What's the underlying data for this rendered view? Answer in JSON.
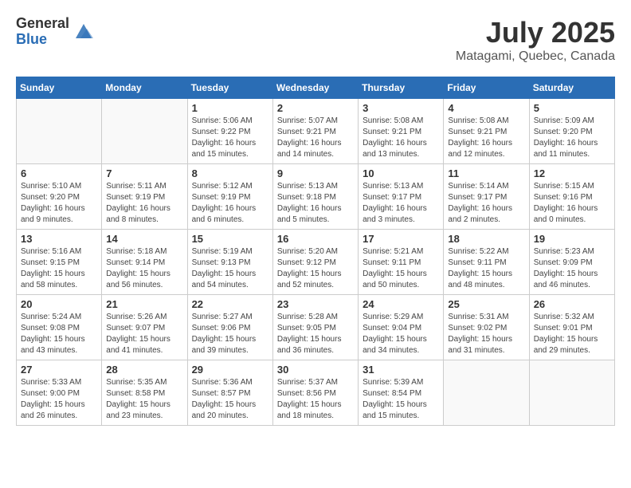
{
  "header": {
    "logo_general": "General",
    "logo_blue": "Blue",
    "month_title": "July 2025",
    "location": "Matagami, Quebec, Canada"
  },
  "days_of_week": [
    "Sunday",
    "Monday",
    "Tuesday",
    "Wednesday",
    "Thursday",
    "Friday",
    "Saturday"
  ],
  "weeks": [
    [
      {
        "day": "",
        "detail": ""
      },
      {
        "day": "",
        "detail": ""
      },
      {
        "day": "1",
        "detail": "Sunrise: 5:06 AM\nSunset: 9:22 PM\nDaylight: 16 hours and 15 minutes."
      },
      {
        "day": "2",
        "detail": "Sunrise: 5:07 AM\nSunset: 9:21 PM\nDaylight: 16 hours and 14 minutes."
      },
      {
        "day": "3",
        "detail": "Sunrise: 5:08 AM\nSunset: 9:21 PM\nDaylight: 16 hours and 13 minutes."
      },
      {
        "day": "4",
        "detail": "Sunrise: 5:08 AM\nSunset: 9:21 PM\nDaylight: 16 hours and 12 minutes."
      },
      {
        "day": "5",
        "detail": "Sunrise: 5:09 AM\nSunset: 9:20 PM\nDaylight: 16 hours and 11 minutes."
      }
    ],
    [
      {
        "day": "6",
        "detail": "Sunrise: 5:10 AM\nSunset: 9:20 PM\nDaylight: 16 hours and 9 minutes."
      },
      {
        "day": "7",
        "detail": "Sunrise: 5:11 AM\nSunset: 9:19 PM\nDaylight: 16 hours and 8 minutes."
      },
      {
        "day": "8",
        "detail": "Sunrise: 5:12 AM\nSunset: 9:19 PM\nDaylight: 16 hours and 6 minutes."
      },
      {
        "day": "9",
        "detail": "Sunrise: 5:13 AM\nSunset: 9:18 PM\nDaylight: 16 hours and 5 minutes."
      },
      {
        "day": "10",
        "detail": "Sunrise: 5:13 AM\nSunset: 9:17 PM\nDaylight: 16 hours and 3 minutes."
      },
      {
        "day": "11",
        "detail": "Sunrise: 5:14 AM\nSunset: 9:17 PM\nDaylight: 16 hours and 2 minutes."
      },
      {
        "day": "12",
        "detail": "Sunrise: 5:15 AM\nSunset: 9:16 PM\nDaylight: 16 hours and 0 minutes."
      }
    ],
    [
      {
        "day": "13",
        "detail": "Sunrise: 5:16 AM\nSunset: 9:15 PM\nDaylight: 15 hours and 58 minutes."
      },
      {
        "day": "14",
        "detail": "Sunrise: 5:18 AM\nSunset: 9:14 PM\nDaylight: 15 hours and 56 minutes."
      },
      {
        "day": "15",
        "detail": "Sunrise: 5:19 AM\nSunset: 9:13 PM\nDaylight: 15 hours and 54 minutes."
      },
      {
        "day": "16",
        "detail": "Sunrise: 5:20 AM\nSunset: 9:12 PM\nDaylight: 15 hours and 52 minutes."
      },
      {
        "day": "17",
        "detail": "Sunrise: 5:21 AM\nSunset: 9:11 PM\nDaylight: 15 hours and 50 minutes."
      },
      {
        "day": "18",
        "detail": "Sunrise: 5:22 AM\nSunset: 9:11 PM\nDaylight: 15 hours and 48 minutes."
      },
      {
        "day": "19",
        "detail": "Sunrise: 5:23 AM\nSunset: 9:09 PM\nDaylight: 15 hours and 46 minutes."
      }
    ],
    [
      {
        "day": "20",
        "detail": "Sunrise: 5:24 AM\nSunset: 9:08 PM\nDaylight: 15 hours and 43 minutes."
      },
      {
        "day": "21",
        "detail": "Sunrise: 5:26 AM\nSunset: 9:07 PM\nDaylight: 15 hours and 41 minutes."
      },
      {
        "day": "22",
        "detail": "Sunrise: 5:27 AM\nSunset: 9:06 PM\nDaylight: 15 hours and 39 minutes."
      },
      {
        "day": "23",
        "detail": "Sunrise: 5:28 AM\nSunset: 9:05 PM\nDaylight: 15 hours and 36 minutes."
      },
      {
        "day": "24",
        "detail": "Sunrise: 5:29 AM\nSunset: 9:04 PM\nDaylight: 15 hours and 34 minutes."
      },
      {
        "day": "25",
        "detail": "Sunrise: 5:31 AM\nSunset: 9:02 PM\nDaylight: 15 hours and 31 minutes."
      },
      {
        "day": "26",
        "detail": "Sunrise: 5:32 AM\nSunset: 9:01 PM\nDaylight: 15 hours and 29 minutes."
      }
    ],
    [
      {
        "day": "27",
        "detail": "Sunrise: 5:33 AM\nSunset: 9:00 PM\nDaylight: 15 hours and 26 minutes."
      },
      {
        "day": "28",
        "detail": "Sunrise: 5:35 AM\nSunset: 8:58 PM\nDaylight: 15 hours and 23 minutes."
      },
      {
        "day": "29",
        "detail": "Sunrise: 5:36 AM\nSunset: 8:57 PM\nDaylight: 15 hours and 20 minutes."
      },
      {
        "day": "30",
        "detail": "Sunrise: 5:37 AM\nSunset: 8:56 PM\nDaylight: 15 hours and 18 minutes."
      },
      {
        "day": "31",
        "detail": "Sunrise: 5:39 AM\nSunset: 8:54 PM\nDaylight: 15 hours and 15 minutes."
      },
      {
        "day": "",
        "detail": ""
      },
      {
        "day": "",
        "detail": ""
      }
    ]
  ]
}
